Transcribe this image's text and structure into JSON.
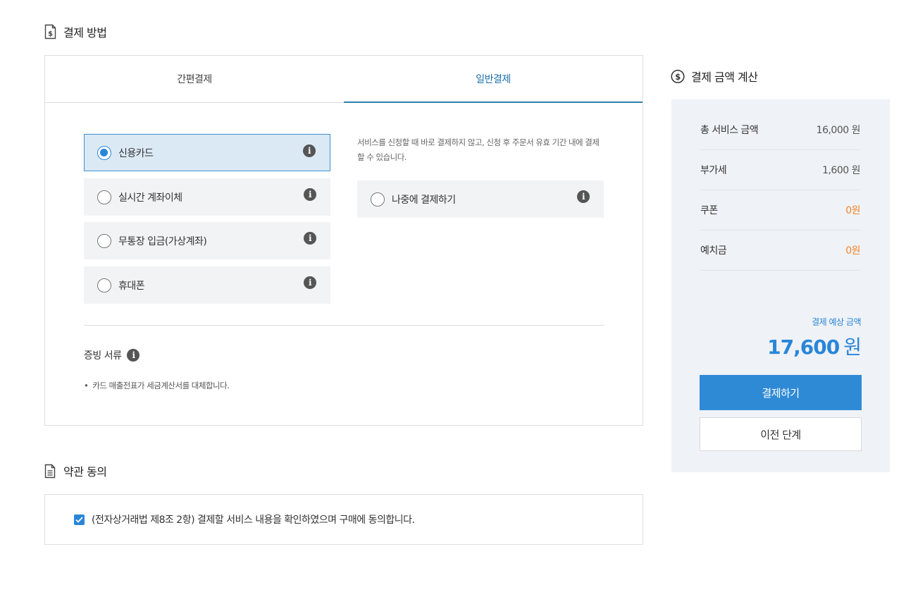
{
  "payment_method": {
    "heading": "결제 방법",
    "tabs": [
      {
        "label": "간편결제",
        "active": false
      },
      {
        "label": "일반결제",
        "active": true
      }
    ],
    "options": [
      {
        "label": "신용카드",
        "selected": true
      },
      {
        "label": "실시간 계좌이체",
        "selected": false
      },
      {
        "label": "무통장 입금(가상계좌)",
        "selected": false
      },
      {
        "label": "휴대폰",
        "selected": false
      }
    ],
    "later_note": "서비스를 신청할 때 바로 결제하지 않고, 신청 후 주문서 유효 기간 내에 결제할 수 있습니다.",
    "later_option": {
      "label": "나중에 결제하기",
      "selected": false
    },
    "receipt": {
      "title": "증빙 서류",
      "bullet": "•",
      "note": "카드 매출전표가 세금계산서를 대체합니다."
    }
  },
  "terms": {
    "heading": "약관 동의",
    "checked": true,
    "text": "(전자상거래법 제8조 2항) 결제할 서비스 내용을 확인하였으며 구매에 동의합니다."
  },
  "summary": {
    "heading": "결제 금액 계산",
    "rows": [
      {
        "label": "총 서비스 금액",
        "value": "16,000 원"
      },
      {
        "label": "부가세",
        "value": "1,600 원"
      },
      {
        "label": "쿠폰",
        "value": "0원"
      },
      {
        "label": "예치금",
        "value": "0원"
      }
    ],
    "expected_label": "결제 예상 금액",
    "expected_amount": "17,600",
    "expected_unit": "원",
    "pay_button": "결제하기",
    "prev_button": "이전 단계"
  },
  "icons": {
    "info": "i"
  },
  "colors": {
    "accent": "#2f8ad6",
    "orange": "#f0862c",
    "panel_bg": "#eff2f6"
  }
}
